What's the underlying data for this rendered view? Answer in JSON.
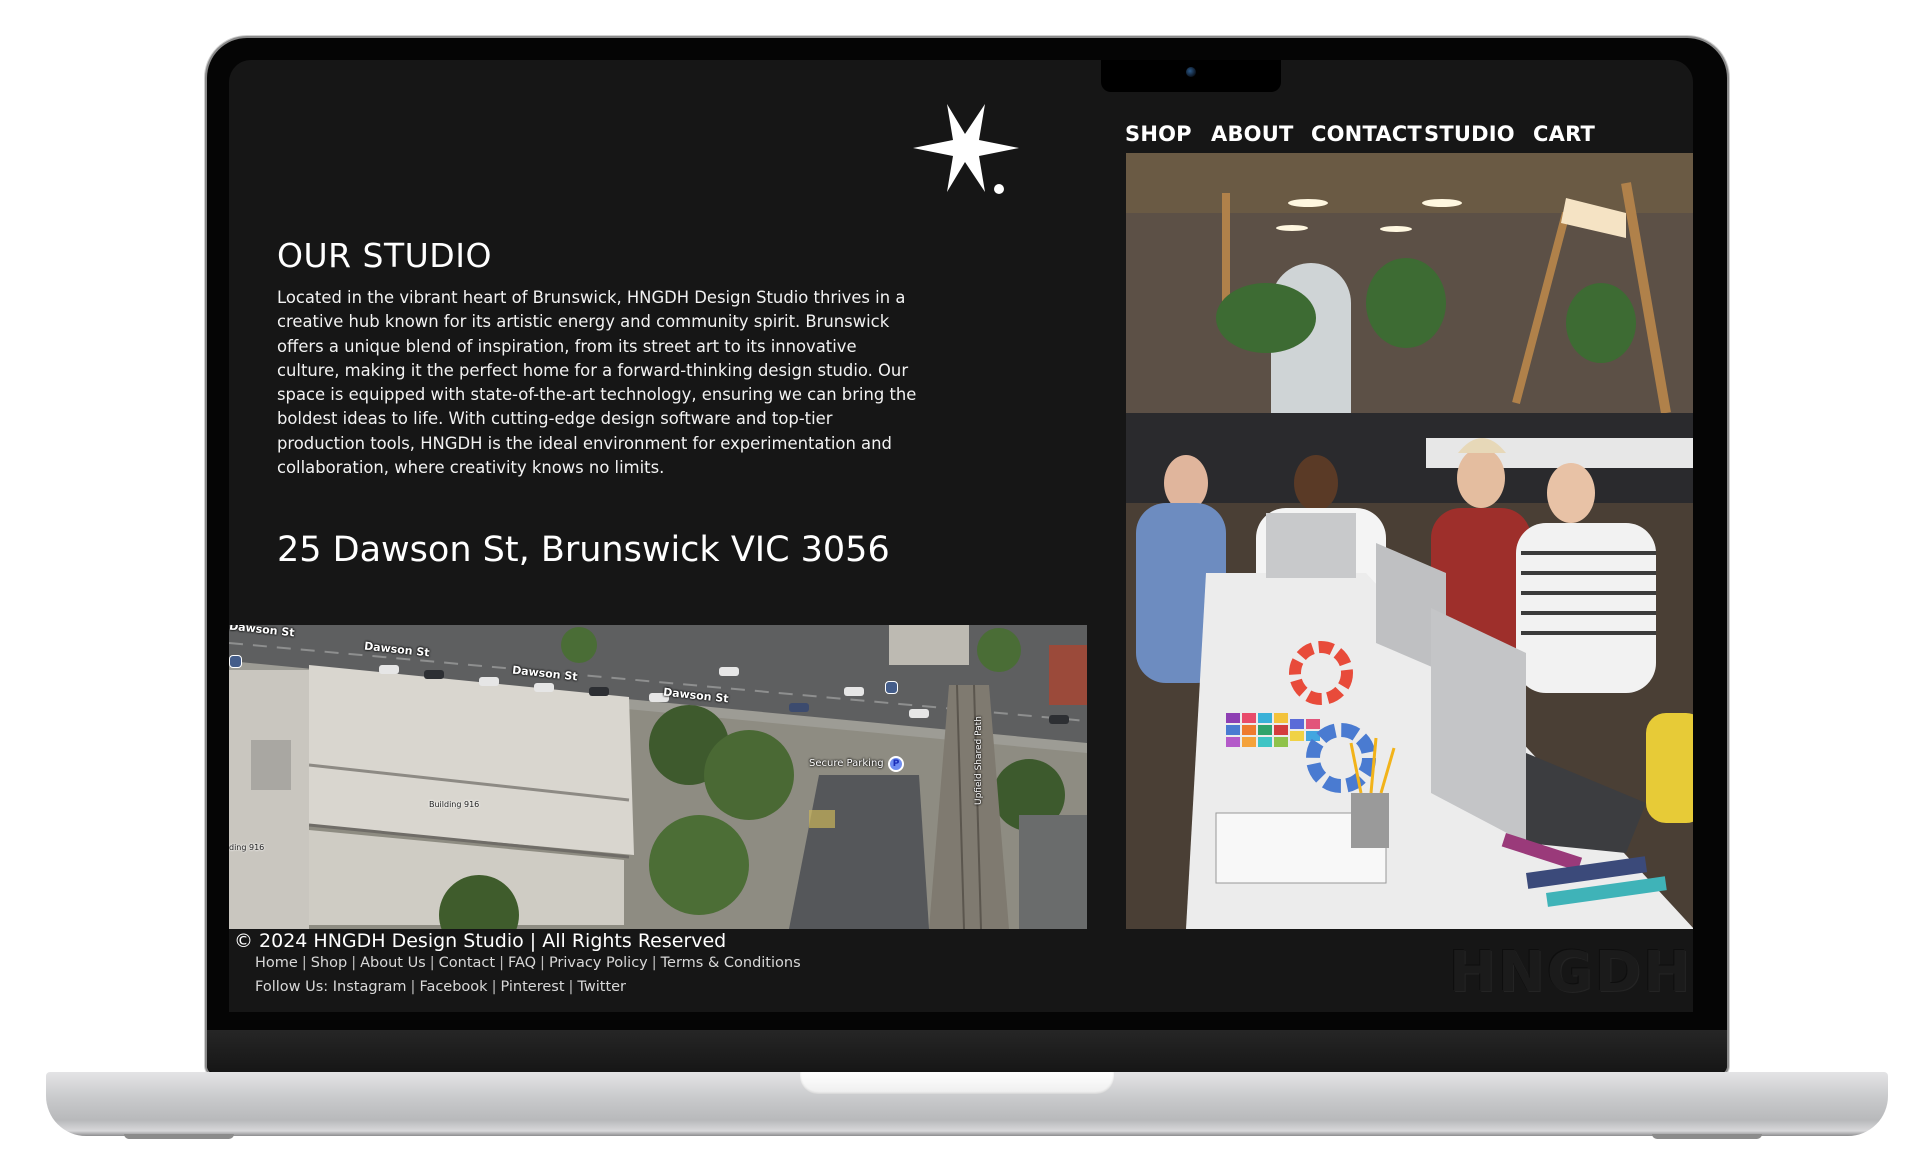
{
  "nav": {
    "items": [
      {
        "label": "SHOP"
      },
      {
        "label": "ABOUT"
      },
      {
        "label": "CONTACT"
      },
      {
        "label": "STUDIO"
      },
      {
        "label": "CART"
      }
    ]
  },
  "logo": {
    "icon": "six-point-star-with-dot"
  },
  "studio": {
    "title": "OUR STUDIO",
    "body": "Located in the vibrant heart of Brunswick, HNGDH Design Studio thrives in a creative hub known for its artistic energy and community spirit. Brunswick offers a unique blend of inspiration, from its street art to its innovative culture, making it the perfect home for a forward-thinking design studio. Our space is equipped with state-of-the-art technology, ensuring we can bring the boldest ideas to life. With cutting-edge design software and top-tier production tools, HNGDH is the ideal environment for experimentation and collaboration, where creativity knows no limits.",
    "address": "25 Dawson St, Brunswick VIC 3056"
  },
  "map": {
    "street_labels": [
      "Dawson St",
      "Dawson St",
      "Dawson St",
      "Dawson St"
    ],
    "poi_parking": "Secure Parking",
    "parking_icon": "P",
    "path_label": "Upfield Shared Path",
    "building_label": "Building 916",
    "building_label_partial": "ding 916"
  },
  "photo": {
    "alt": "Designers collaborating around a table with laptops and colour swatches"
  },
  "footer": {
    "copyright": "© 2024 HNGDH Design Studio | All Rights Reserved",
    "links": [
      "Home",
      "Shop",
      "About Us",
      "Contact",
      "FAQ",
      "Privacy Policy",
      "Terms & Conditions"
    ],
    "follow_label": "Follow Us:",
    "social": [
      "Instagram",
      "Facebook",
      "Pinterest",
      "Twitter"
    ],
    "watermark": "HNGDH"
  },
  "colors": {
    "page_bg": "#161616",
    "text": "#ffffff",
    "laptop_bezel": "#050505",
    "laptop_silver": "#c9cacc"
  }
}
